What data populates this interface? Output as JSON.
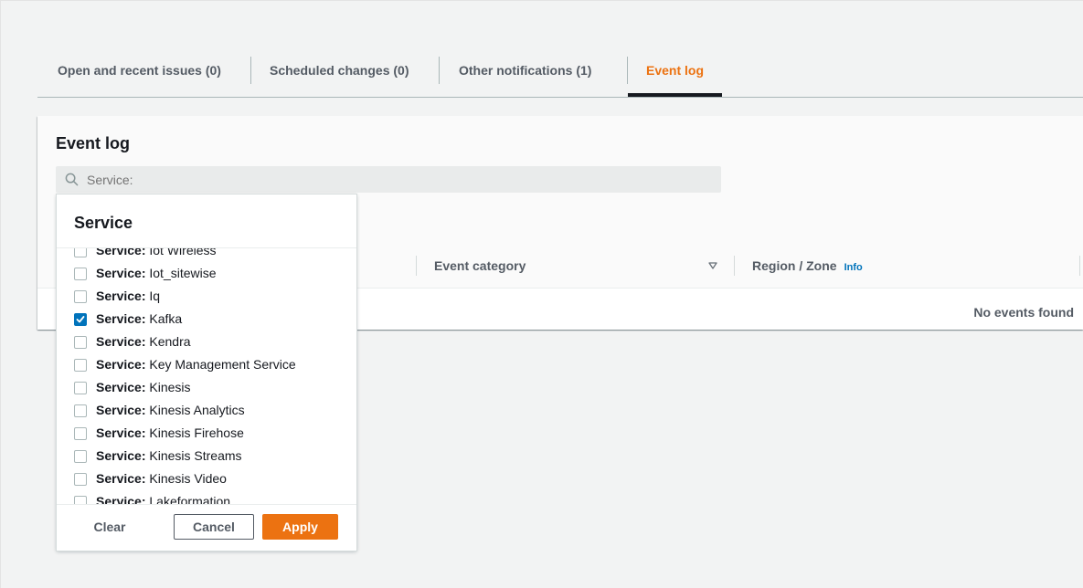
{
  "tabs": [
    {
      "label": "Open and recent issues (0)"
    },
    {
      "label": "Scheduled changes (0)"
    },
    {
      "label": "Other notifications (1)"
    },
    {
      "label": "Event log"
    }
  ],
  "active_tab": "Event log",
  "panel": {
    "title": "Event log",
    "search": {
      "placeholder": "Service:",
      "value": ""
    },
    "columns": [
      {
        "label": "Event category"
      },
      {
        "label": "Region / Zone",
        "info": "Info"
      }
    ],
    "empty_text": "No events found"
  },
  "dropdown": {
    "title": "Service",
    "options": [
      {
        "key": "Service:",
        "value": "Iot Wireless",
        "checked": false
      },
      {
        "key": "Service:",
        "value": "Iot_sitewise",
        "checked": false
      },
      {
        "key": "Service:",
        "value": "Iq",
        "checked": false
      },
      {
        "key": "Service:",
        "value": "Kafka",
        "checked": true
      },
      {
        "key": "Service:",
        "value": "Kendra",
        "checked": false
      },
      {
        "key": "Service:",
        "value": "Key Management Service",
        "checked": false
      },
      {
        "key": "Service:",
        "value": "Kinesis",
        "checked": false
      },
      {
        "key": "Service:",
        "value": "Kinesis Analytics",
        "checked": false
      },
      {
        "key": "Service:",
        "value": "Kinesis Firehose",
        "checked": false
      },
      {
        "key": "Service:",
        "value": "Kinesis Streams",
        "checked": false
      },
      {
        "key": "Service:",
        "value": "Kinesis Video",
        "checked": false
      },
      {
        "key": "Service:",
        "value": "Lakeformation",
        "checked": false
      }
    ],
    "buttons": {
      "clear": "Clear",
      "cancel": "Cancel",
      "apply": "Apply"
    }
  },
  "colors": {
    "accent": "#ec7211",
    "link": "#0073bb",
    "checkbox_checked": "#0073bb"
  }
}
